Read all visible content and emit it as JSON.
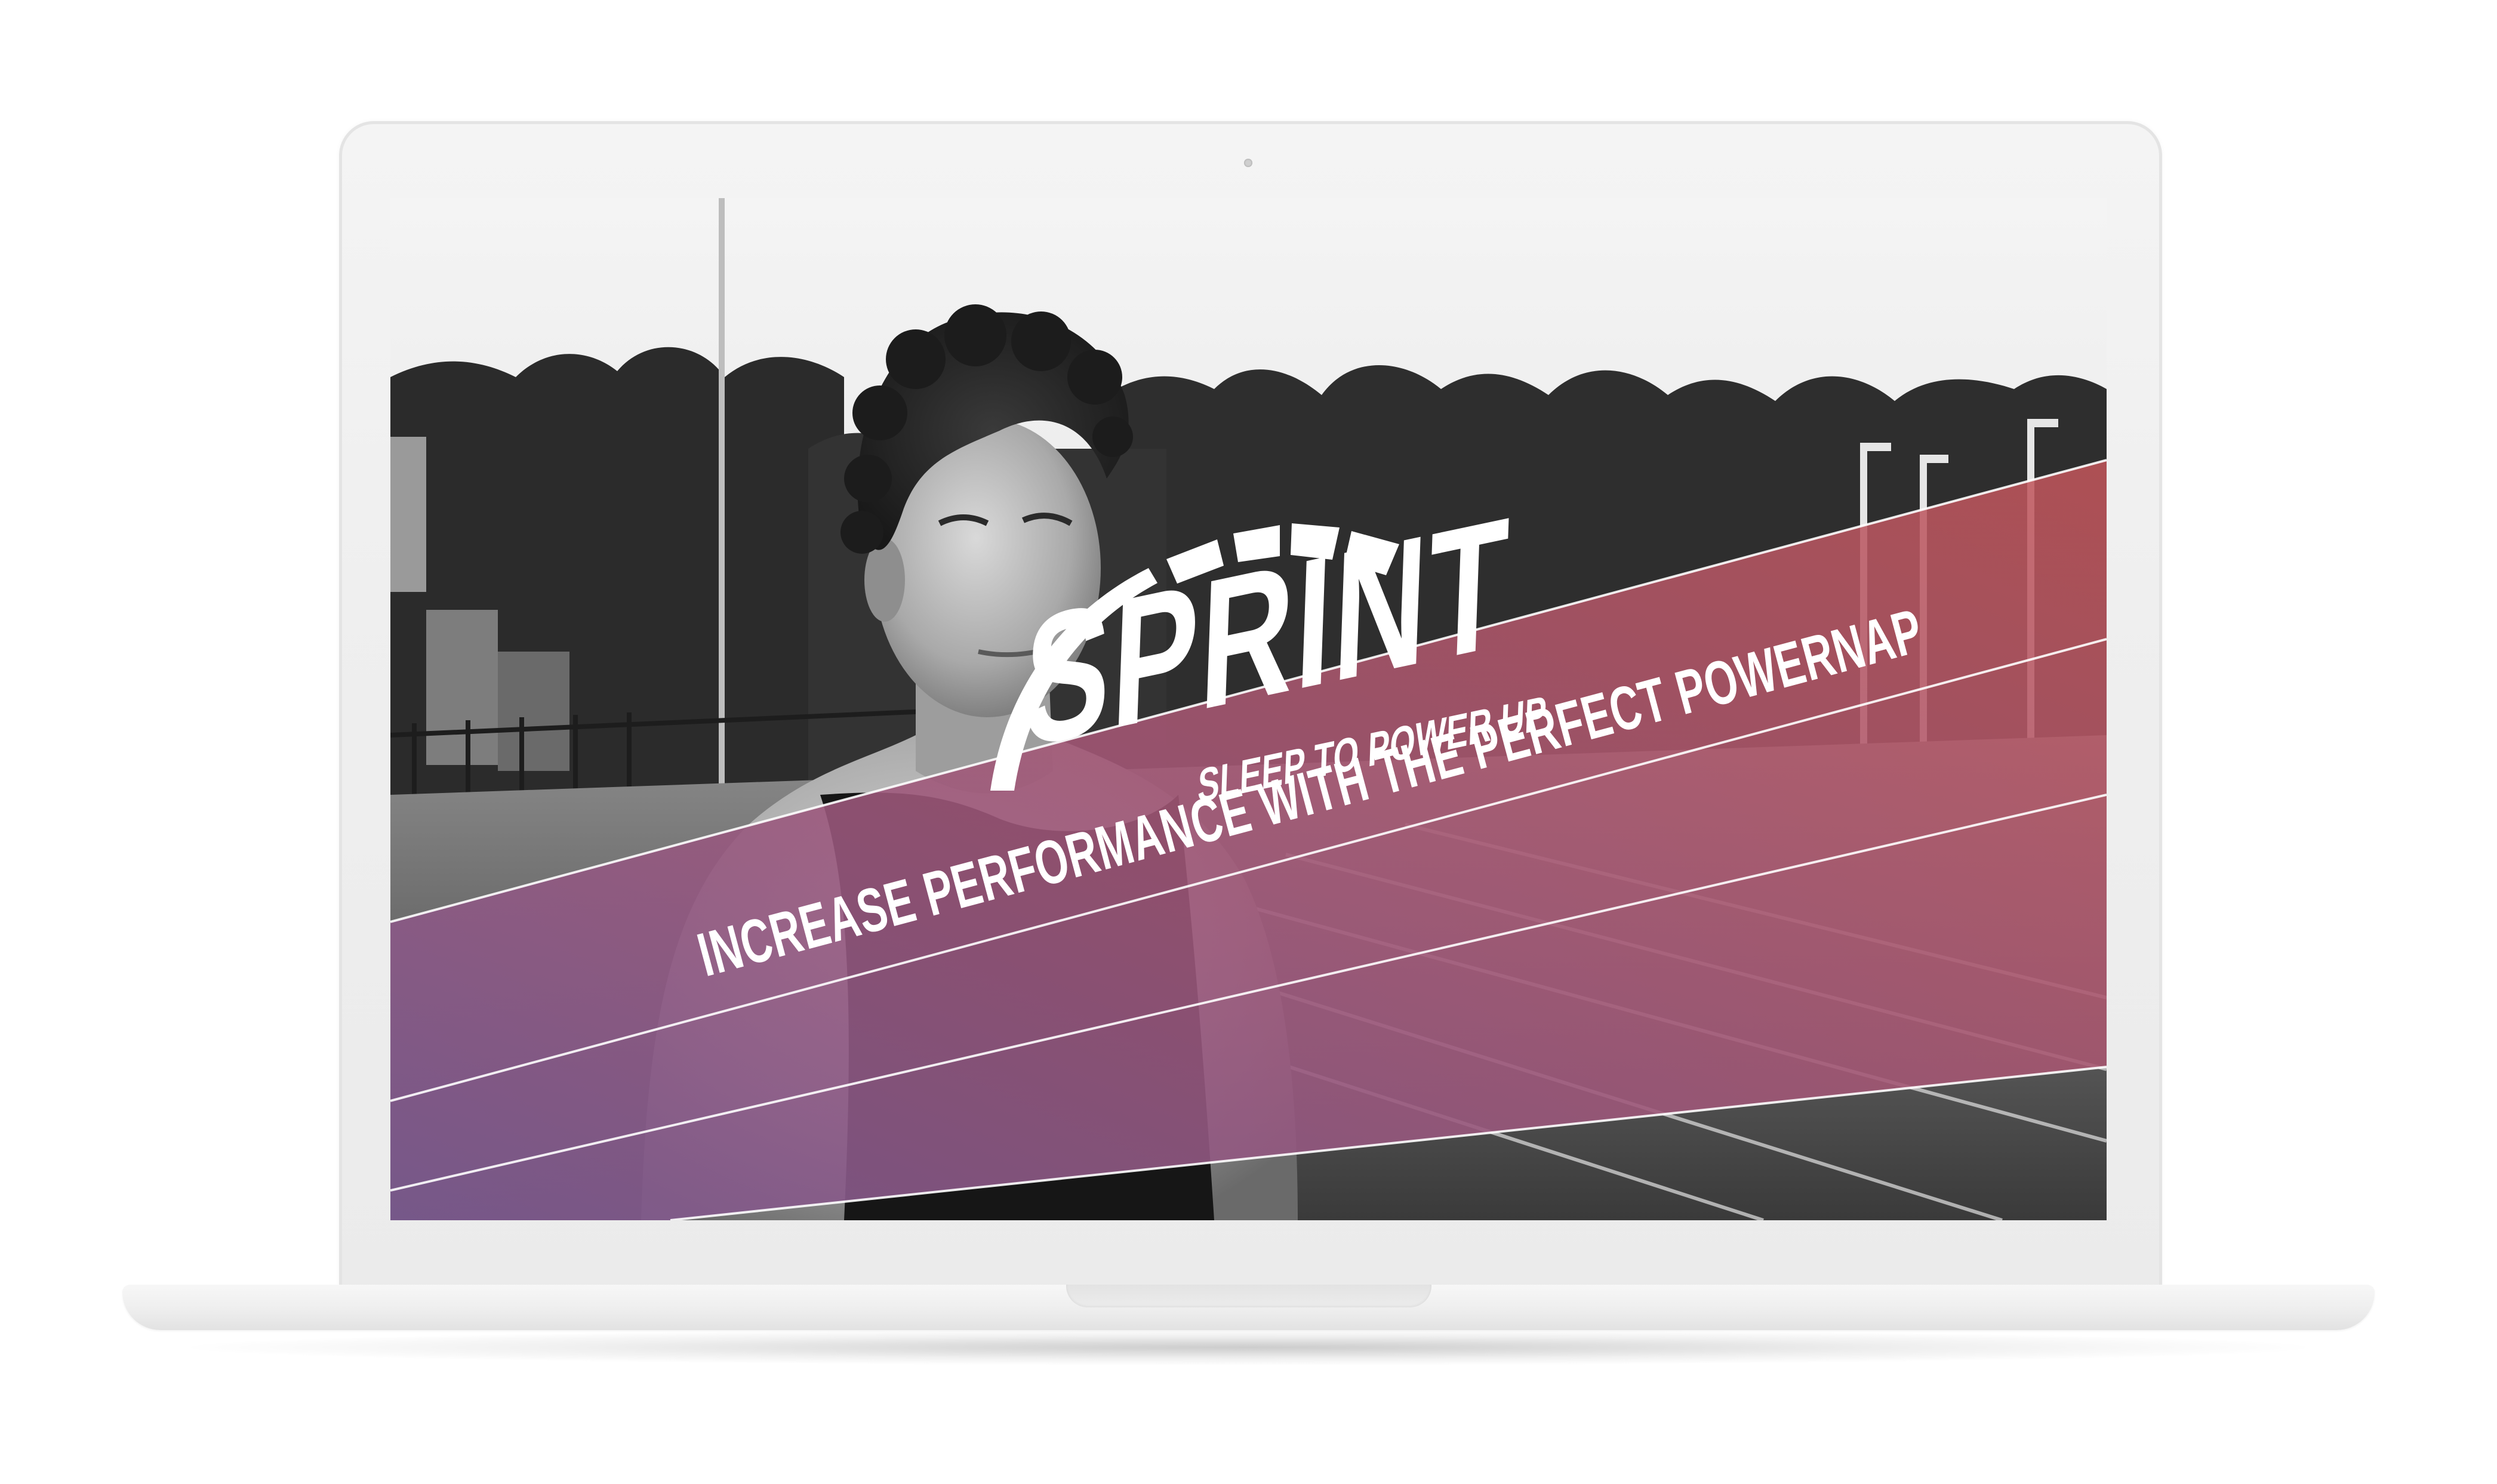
{
  "brand": {
    "name": "SPRINT",
    "tagline": "SLEEP TO POWER UP"
  },
  "hero": {
    "headline": "INCREASE PERFORMANCE WITH THE PERFECT POWERNAP"
  },
  "colors": {
    "gradient_start": "#7a5a8f",
    "gradient_mid": "#a2587a",
    "gradient_end": "#c0575a",
    "logo": "#ffffff"
  },
  "icons": {
    "logo_mark": "speedometer-arc-icon"
  }
}
